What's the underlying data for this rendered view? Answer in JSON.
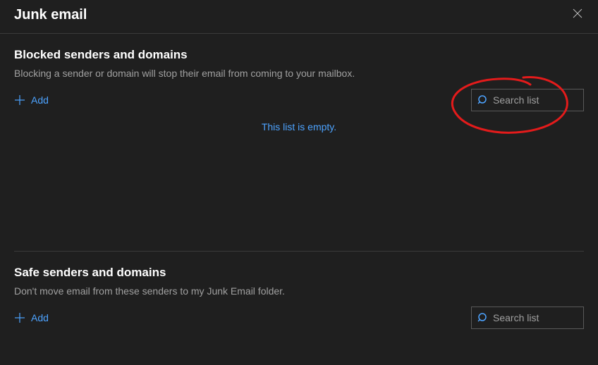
{
  "page": {
    "title": "Junk email"
  },
  "blocked": {
    "heading": "Blocked senders and domains",
    "description": "Blocking a sender or domain will stop their email from coming to your mailbox.",
    "add_label": "Add",
    "search_placeholder": "Search list",
    "empty_message": "This list is empty."
  },
  "safe": {
    "heading": "Safe senders and domains",
    "description": "Don't move email from these senders to my Junk Email folder.",
    "add_label": "Add",
    "search_placeholder": "Search list"
  }
}
